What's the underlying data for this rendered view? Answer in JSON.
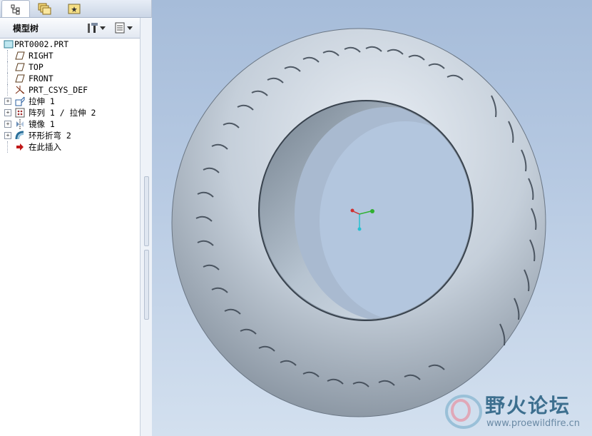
{
  "tabs": [
    {
      "name": "model-tree-tab",
      "icon": "tree-icon"
    },
    {
      "name": "folder-browser-tab",
      "icon": "folders-icon"
    },
    {
      "name": "favorites-tab",
      "icon": "star-folder-icon"
    }
  ],
  "model_tree": {
    "title": "模型树",
    "settings_icon": "tools-icon",
    "show_icon": "list-icon",
    "items": [
      {
        "label": "PRT0002.PRT",
        "icon": "part-icon",
        "expandable": false
      },
      {
        "label": "RIGHT",
        "icon": "datum-plane-icon",
        "expandable": false
      },
      {
        "label": "TOP",
        "icon": "datum-plane-icon",
        "expandable": false
      },
      {
        "label": "FRONT",
        "icon": "datum-plane-icon",
        "expandable": false
      },
      {
        "label": "PRT_CSYS_DEF",
        "icon": "csys-icon",
        "expandable": false
      },
      {
        "label": "拉伸 1",
        "icon": "extrude-icon",
        "expandable": true
      },
      {
        "label": "阵列 1 / 拉伸 2",
        "icon": "pattern-icon",
        "expandable": true
      },
      {
        "label": "镜像 1",
        "icon": "mirror-icon",
        "expandable": true
      },
      {
        "label": "环形折弯 2",
        "icon": "toroidal-bend-icon",
        "expandable": true
      },
      {
        "label": "在此插入",
        "icon": "insert-arrow-icon",
        "expandable": false
      }
    ]
  },
  "watermark": {
    "title": "野火论坛",
    "url": "www.proewildfire.cn"
  },
  "colors": {
    "viewport_top": "#a6bcd9",
    "viewport_bottom": "#d3e0ef",
    "model": "#c7d1dc"
  }
}
